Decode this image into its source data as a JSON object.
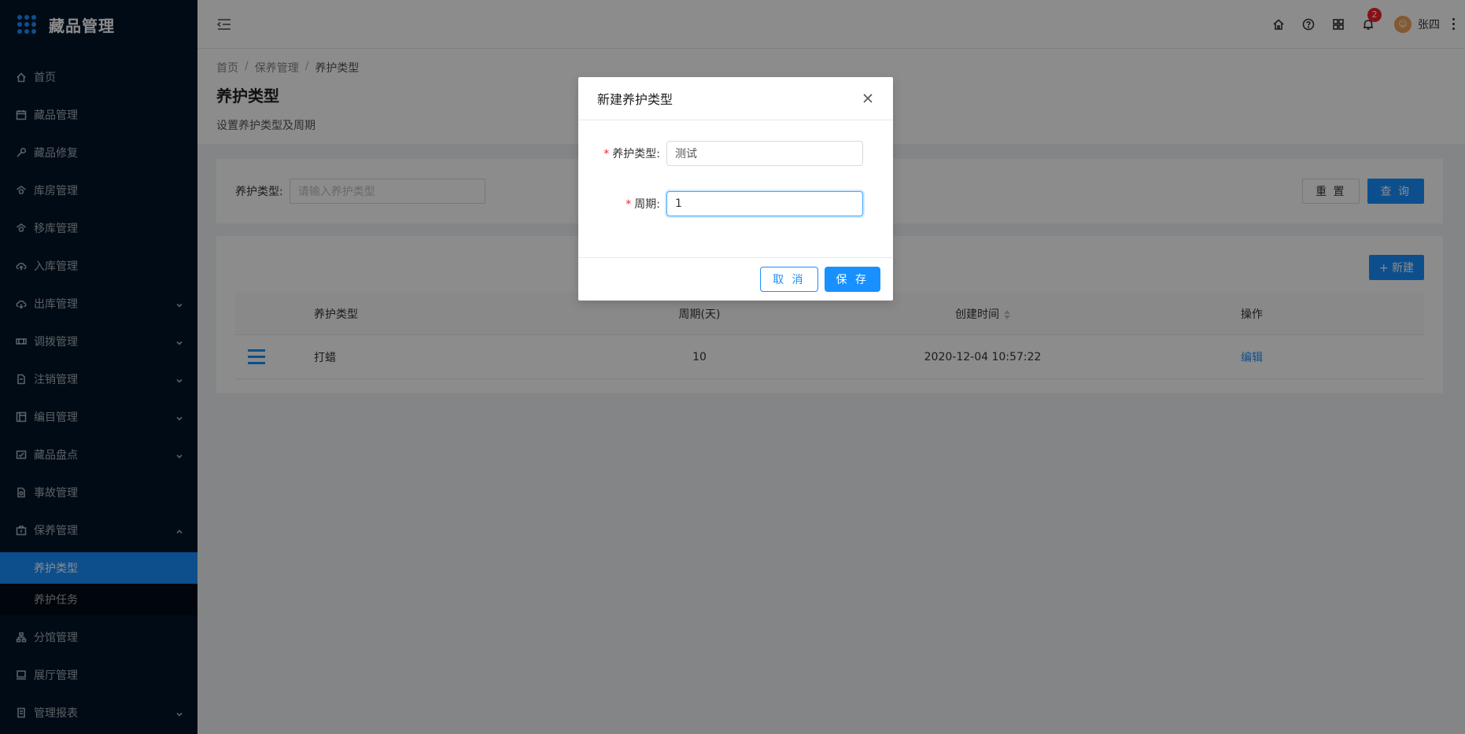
{
  "app": {
    "title": "藏品管理"
  },
  "sidebar": {
    "items": [
      {
        "label": "首页",
        "icon": "home-icon",
        "arrow": ""
      },
      {
        "label": "藏品管理",
        "icon": "calendar-icon",
        "arrow": ""
      },
      {
        "label": "藏品修复",
        "icon": "wrench-icon",
        "arrow": ""
      },
      {
        "label": "库房管理",
        "icon": "warehouse-icon",
        "arrow": ""
      },
      {
        "label": "移库管理",
        "icon": "transfer-icon",
        "arrow": ""
      },
      {
        "label": "入库管理",
        "icon": "cloud-upload-icon",
        "arrow": ""
      },
      {
        "label": "出库管理",
        "icon": "cloud-download-icon",
        "arrow": "down"
      },
      {
        "label": "调拨管理",
        "icon": "allocate-icon",
        "arrow": "down"
      },
      {
        "label": "注销管理",
        "icon": "file-icon",
        "arrow": "down"
      },
      {
        "label": "编目管理",
        "icon": "catalog-icon",
        "arrow": "down"
      },
      {
        "label": "藏品盘点",
        "icon": "inventory-icon",
        "arrow": "down"
      },
      {
        "label": "事故管理",
        "icon": "accident-icon",
        "arrow": ""
      },
      {
        "label": "保养管理",
        "icon": "maintenance-icon",
        "arrow": "up"
      }
    ],
    "sub_items": [
      {
        "label": "养护类型",
        "active": true
      },
      {
        "label": "养护任务",
        "active": false
      }
    ],
    "items_after": [
      {
        "label": "分馆管理",
        "icon": "branch-icon",
        "arrow": ""
      },
      {
        "label": "展厅管理",
        "icon": "exhibit-icon",
        "arrow": ""
      },
      {
        "label": "管理报表",
        "icon": "report-icon",
        "arrow": "down"
      }
    ]
  },
  "header": {
    "notification_count": "2",
    "username": "张四",
    "icons": [
      "home-icon",
      "help-icon",
      "apps-icon",
      "bell-icon"
    ]
  },
  "page": {
    "breadcrumb": [
      "首页",
      "保养管理",
      "养护类型"
    ],
    "title": "养护类型",
    "description": "设置养护类型及周期"
  },
  "search": {
    "label": "养护类型:",
    "placeholder": "请输入养护类型",
    "reset_label": "重 置",
    "query_label": "查 询"
  },
  "table": {
    "new_label": "+ 新建",
    "columns": [
      "养护类型",
      "周期(天)",
      "创建时间",
      "操作"
    ],
    "rows": [
      {
        "type": "打蜡",
        "period": "10",
        "created": "2020-12-04 10:57:22",
        "action": "编辑"
      }
    ]
  },
  "modal": {
    "title": "新建养护类型",
    "fields": [
      {
        "label": "养护类型:",
        "value": "测试",
        "required": true
      },
      {
        "label": "周期:",
        "value": "1",
        "required": true
      }
    ],
    "cancel_label": "取 消",
    "save_label": "保 存"
  },
  "colors": {
    "primary": "#1890ff",
    "sidebar_bg": "#001529",
    "danger": "#f5222d"
  }
}
